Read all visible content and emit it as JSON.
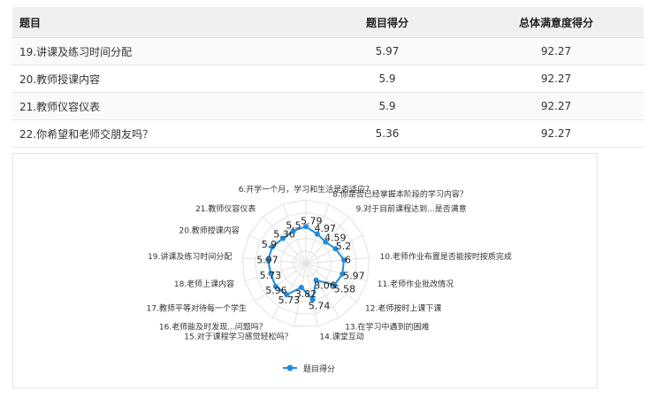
{
  "table": {
    "headers": [
      "题目",
      "题目得分",
      "总体满意度得分"
    ],
    "rows": [
      {
        "question": "19.讲课及练习时间分配",
        "score": "5.97",
        "overall": "92.27"
      },
      {
        "question": "20.教师授课内容",
        "score": "5.9",
        "overall": "92.27"
      },
      {
        "question": "21.教师仪容仪表",
        "score": "5.9",
        "overall": "92.27"
      },
      {
        "question": "22.你希望和老师交朋友吗？",
        "score": "5.36",
        "overall": "92.27"
      }
    ]
  },
  "chart_data": {
    "type": "radar",
    "categories": [
      "6.开学一个月，学习和生活是否适应？",
      "8.你是否已经掌握本阶段的学习内容？",
      "9.对于目前课程达到...是否满意",
      "",
      "10.老师作业布置是否能按时按质完成",
      "11.老师作业批改情况",
      "12.老师按时上课下课",
      "13.在学习中遇到的困难",
      "14.课堂互动",
      "15.对于课程学习感觉轻松吗？",
      "16.老师能及时发现...问题吗？",
      "17.教师平等对待每一个学生",
      "18.老师上课内容",
      "19.讲课及练习时间分配",
      "20.教师授课内容",
      "21.教师仪容仪表",
      ""
    ],
    "series": [
      {
        "name": "题目得分",
        "values": [
          5.79,
          4.97,
          4.59,
          5.2,
          6,
          5.97,
          5.58,
          3.06,
          5.74,
          3.82,
          5.73,
          5.96,
          5.73,
          5.97,
          5.9,
          5.36,
          5.5
        ]
      }
    ],
    "rmax": 10,
    "legend": "bottom",
    "color": "#1f8ddc"
  }
}
